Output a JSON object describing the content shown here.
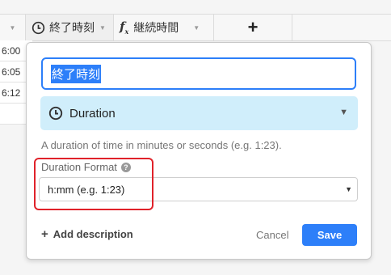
{
  "grid": {
    "columns": [
      {
        "label": "終了時刻",
        "icon": "clock-icon"
      },
      {
        "label": "継続時間",
        "icon": "formula-fx-icon"
      }
    ],
    "add_column_label": "+",
    "rows": [
      "6:00",
      "6:05",
      "6:12",
      ""
    ]
  },
  "field_editor": {
    "name_value": "終了時刻",
    "type_label": "Duration",
    "type_icon": "clock-icon",
    "description": "A duration of time in minutes or seconds (e.g. 1:23).",
    "format_label": "Duration Format",
    "format_value": "h:mm (e.g. 1:23)",
    "add_description_label": "Add description",
    "cancel_label": "Cancel",
    "save_label": "Save"
  },
  "colors": {
    "accent": "#2d7ff9",
    "type_bg": "#d0eefb",
    "highlight": "#e0222a"
  }
}
